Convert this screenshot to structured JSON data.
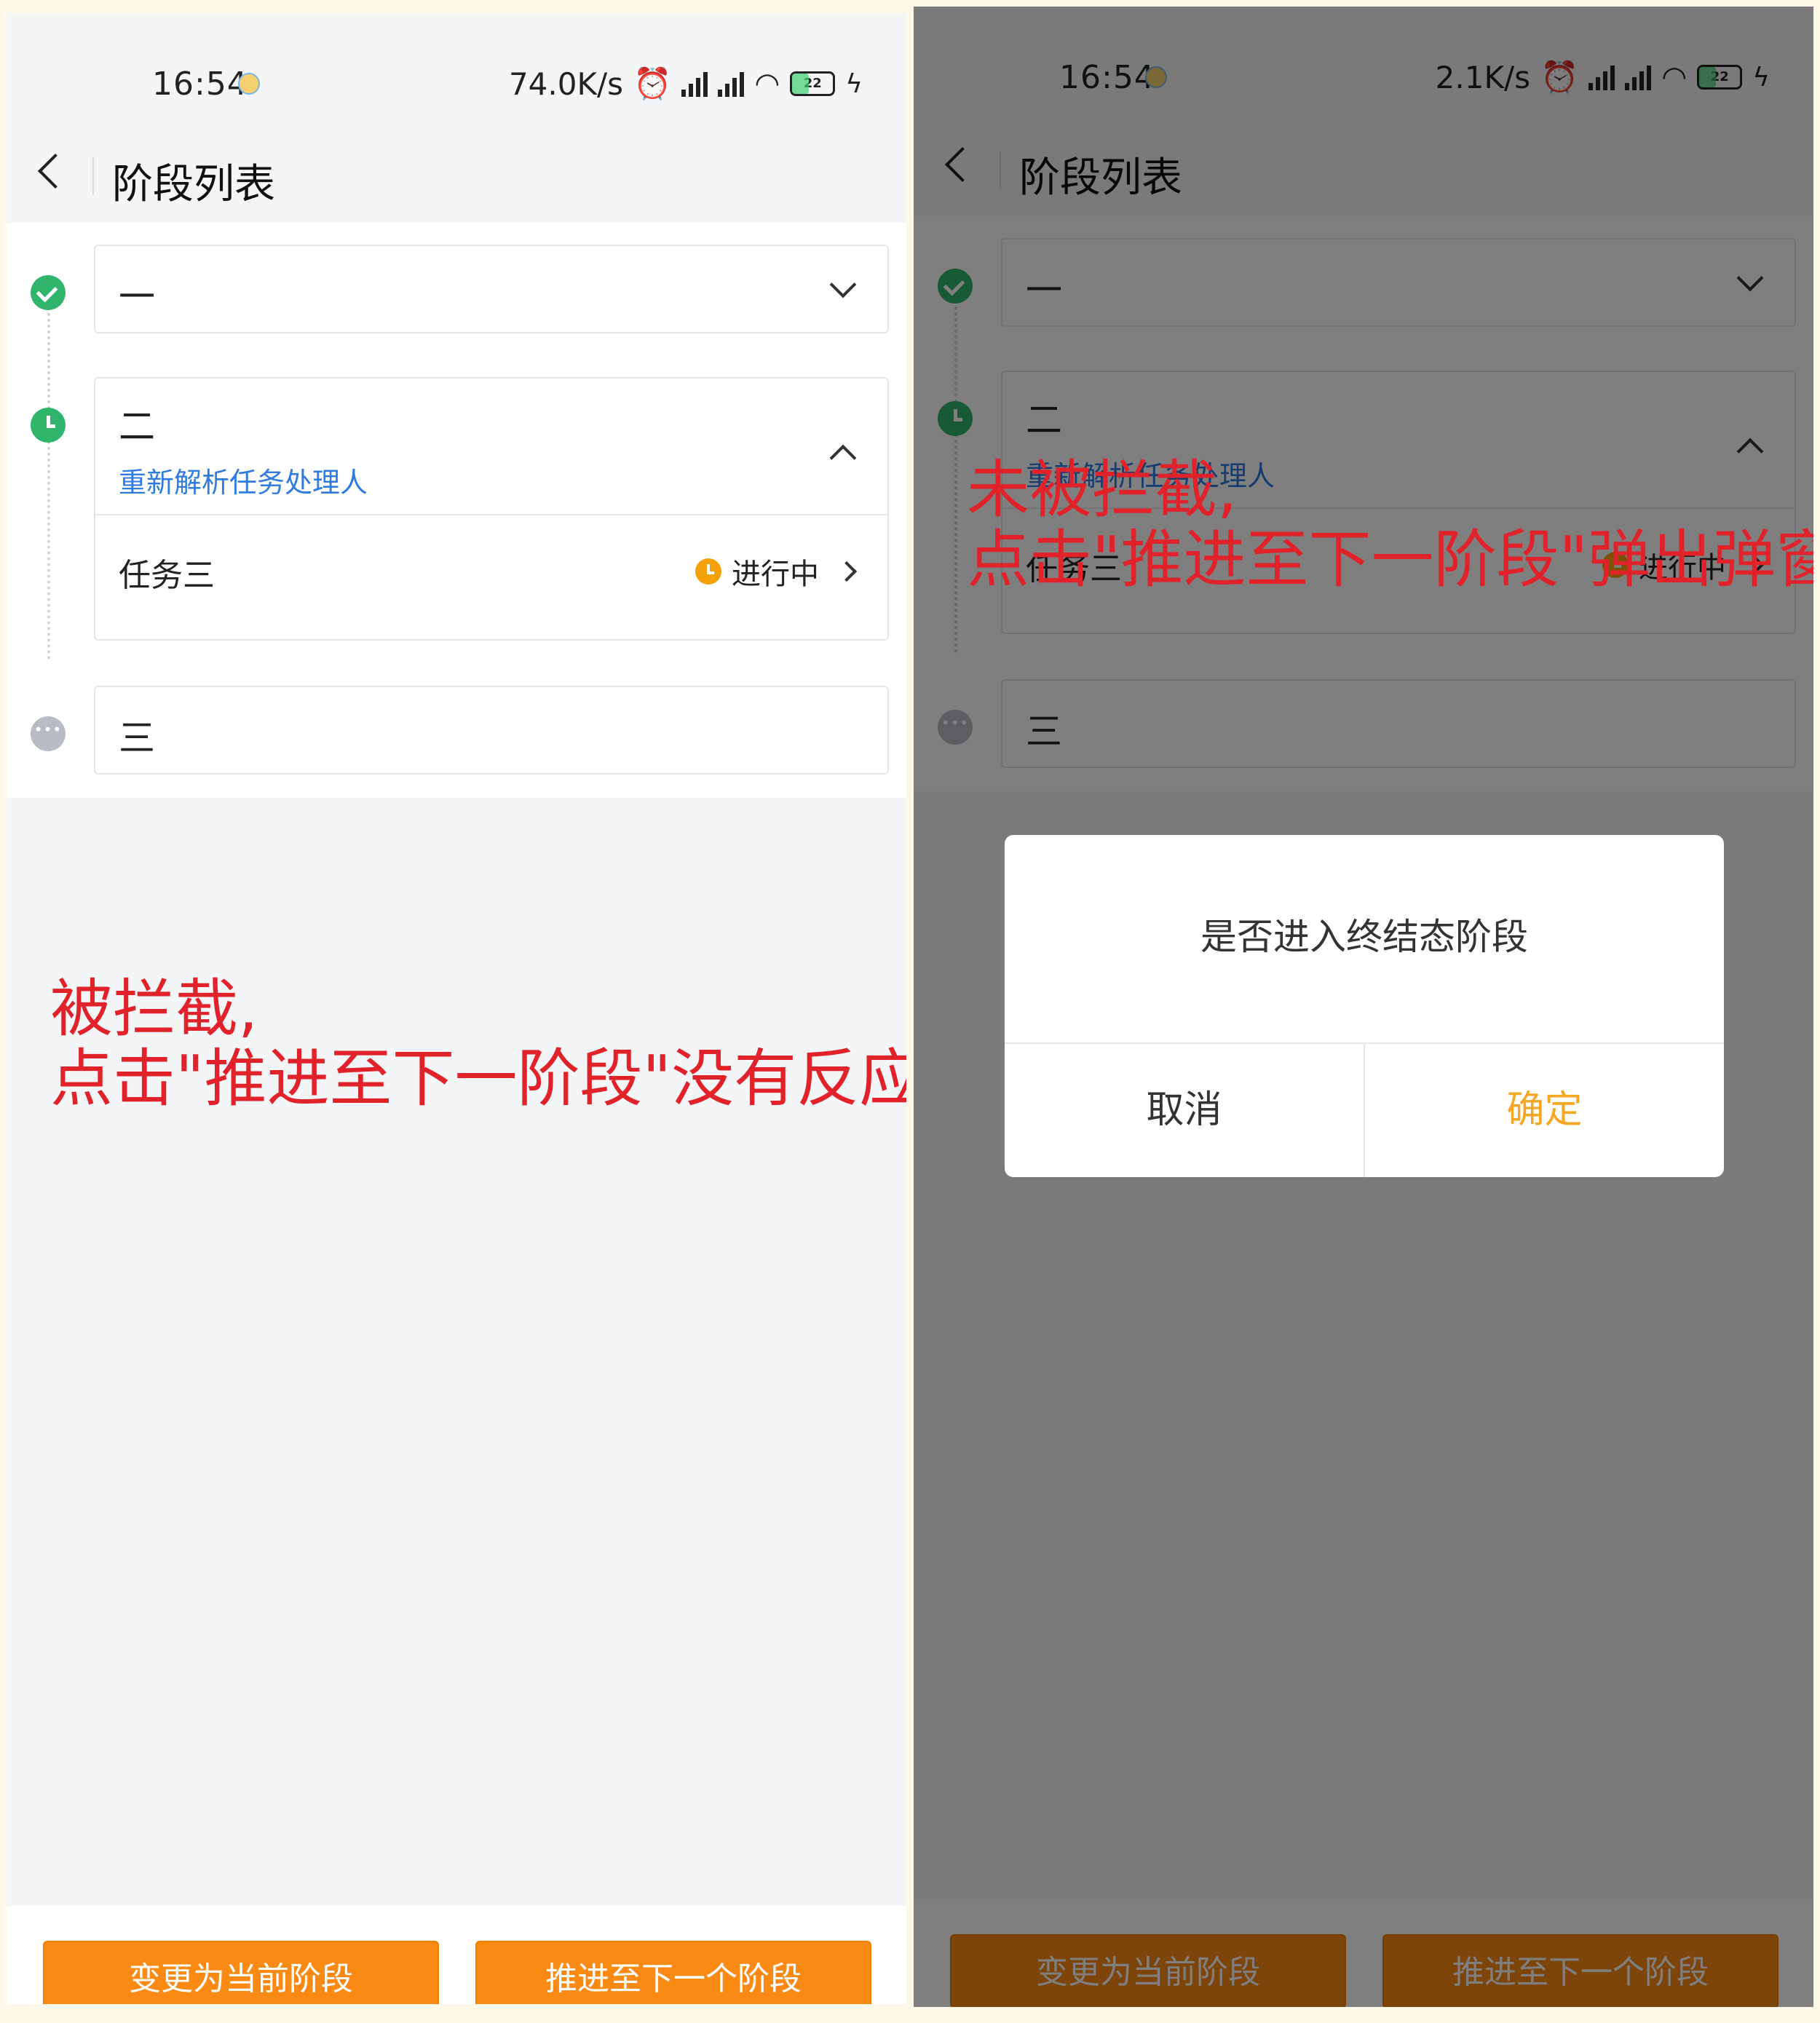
{
  "left": {
    "status_bar": {
      "time": "16:54",
      "speed": "74.0K/s",
      "battery": "22"
    },
    "header": {
      "title": "阶段列表"
    },
    "stages": [
      {
        "name": "一",
        "state": "done"
      },
      {
        "name": "二",
        "state": "active",
        "link": "重新解析任务处理人",
        "task": {
          "name": "任务三",
          "status": "进行中"
        }
      },
      {
        "name": "三",
        "state": "pending"
      }
    ],
    "annotation": [
      "被拦截,",
      "点击\"推进至下一阶段\"没有反应"
    ],
    "buttons": {
      "change": "变更为当前阶段",
      "advance": "推进至下一个阶段"
    }
  },
  "right": {
    "status_bar": {
      "time": "16:54",
      "speed": "2.1K/s",
      "battery": "22"
    },
    "header": {
      "title": "阶段列表"
    },
    "stages": [
      {
        "name": "一",
        "state": "done"
      },
      {
        "name": "二",
        "state": "active",
        "link": "重新解析任务处理人",
        "task": {
          "name": "任务三",
          "status": "进行中"
        }
      },
      {
        "name": "三",
        "state": "pending"
      }
    ],
    "annotation": [
      "未被拦截,",
      "点击\"推进至下一阶段\"弹出弹窗"
    ],
    "dialog": {
      "message": "是否进入终结态阶段",
      "cancel": "取消",
      "confirm": "确定"
    },
    "buttons": {
      "change": "变更为当前阶段",
      "advance": "推进至下一个阶段"
    }
  },
  "colors": {
    "accent": "#fb8a14",
    "done": "#31b46b",
    "link": "#2f7be0",
    "annotation": "#e1222a",
    "confirm": "#f5a623"
  }
}
